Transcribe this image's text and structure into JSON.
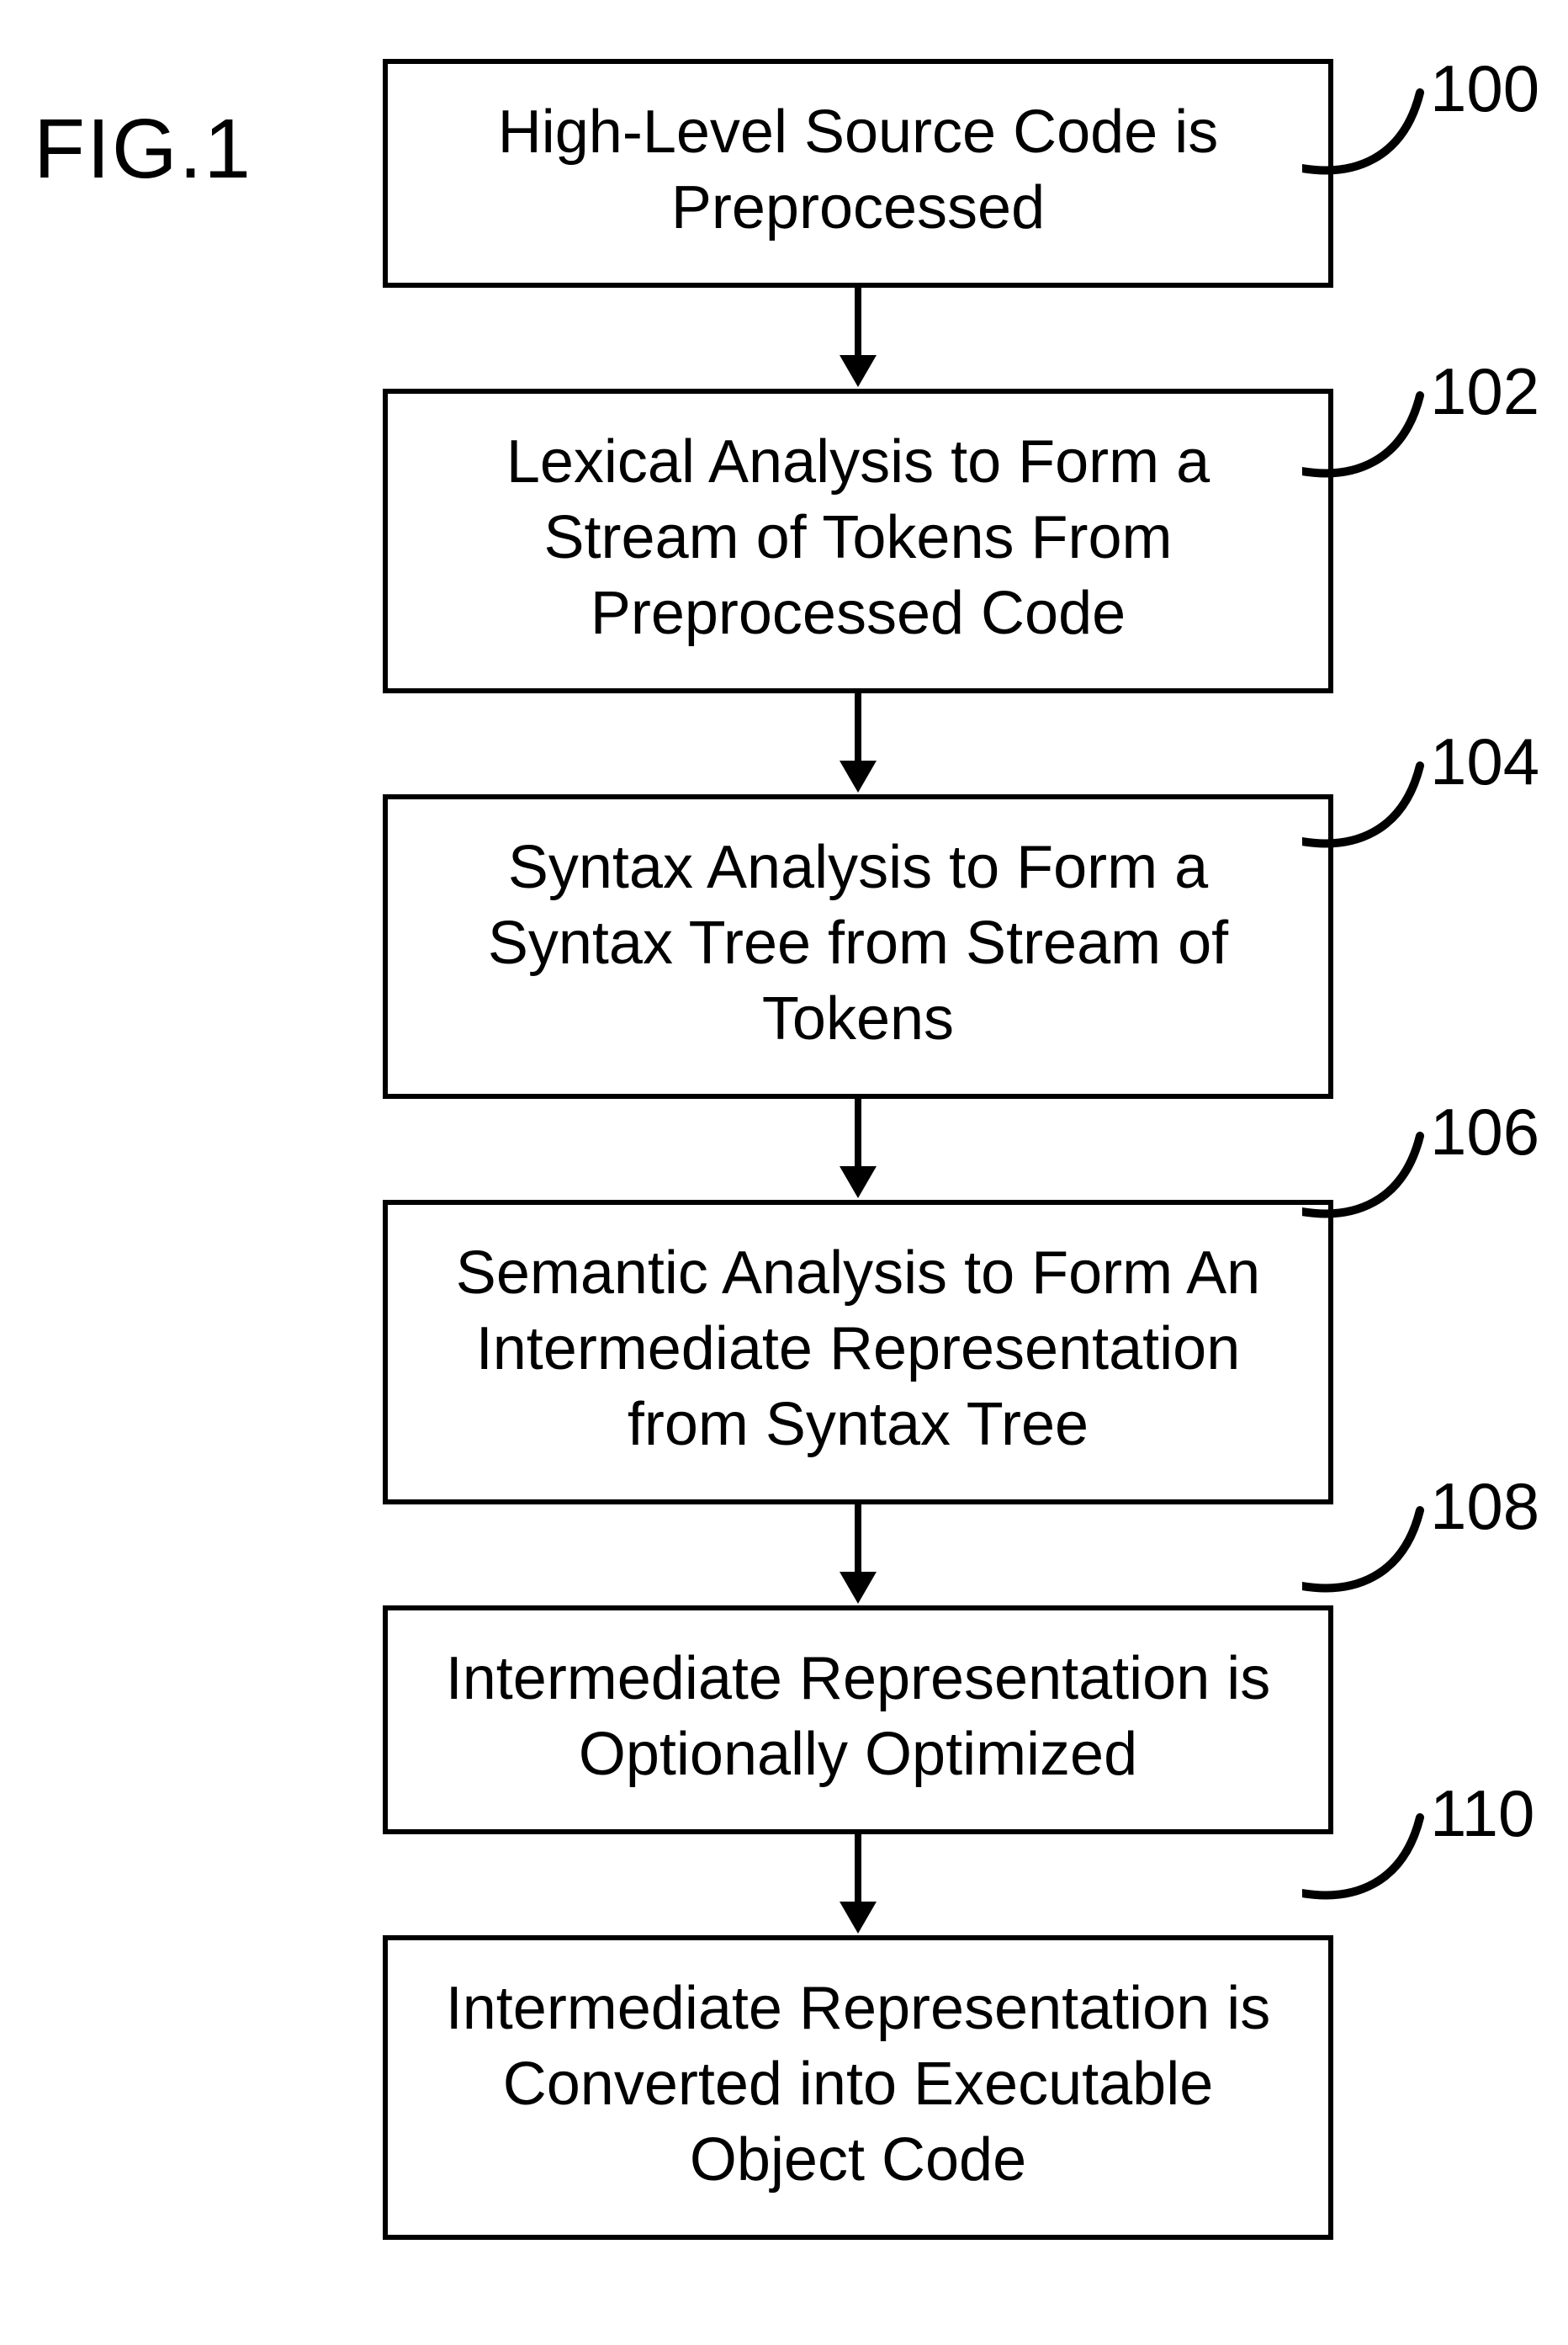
{
  "figure_label": "FIG.1",
  "steps": [
    {
      "ref": "100",
      "text": "High-Level Source Code is Preprocessed"
    },
    {
      "ref": "102",
      "text": "Lexical Analysis to Form a Stream of Tokens From Preprocessed Code"
    },
    {
      "ref": "104",
      "text": "Syntax Analysis to Form a Syntax Tree from Stream of Tokens"
    },
    {
      "ref": "106",
      "text": "Semantic Analysis to Form An Intermediate Representation from Syntax Tree"
    },
    {
      "ref": "108",
      "text": "Intermediate Representation is Optionally Optimized"
    },
    {
      "ref": "110",
      "text": "Intermediate Representation is Converted into Executable Object Code"
    }
  ],
  "chart_data": {
    "type": "flowchart",
    "title": "FIG.1",
    "direction": "top-to-bottom",
    "nodes": [
      {
        "id": "100",
        "label": "High-Level Source Code is Preprocessed"
      },
      {
        "id": "102",
        "label": "Lexical Analysis to Form a Stream of Tokens From Preprocessed Code"
      },
      {
        "id": "104",
        "label": "Syntax Analysis to Form a Syntax Tree from Stream of Tokens"
      },
      {
        "id": "106",
        "label": "Semantic Analysis to Form An Intermediate Representation from Syntax Tree"
      },
      {
        "id": "108",
        "label": "Intermediate Representation is Optionally Optimized"
      },
      {
        "id": "110",
        "label": "Intermediate Representation is Converted into Executable Object Code"
      }
    ],
    "edges": [
      {
        "from": "100",
        "to": "102"
      },
      {
        "from": "102",
        "to": "104"
      },
      {
        "from": "104",
        "to": "106"
      },
      {
        "from": "106",
        "to": "108"
      },
      {
        "from": "108",
        "to": "110"
      }
    ]
  }
}
